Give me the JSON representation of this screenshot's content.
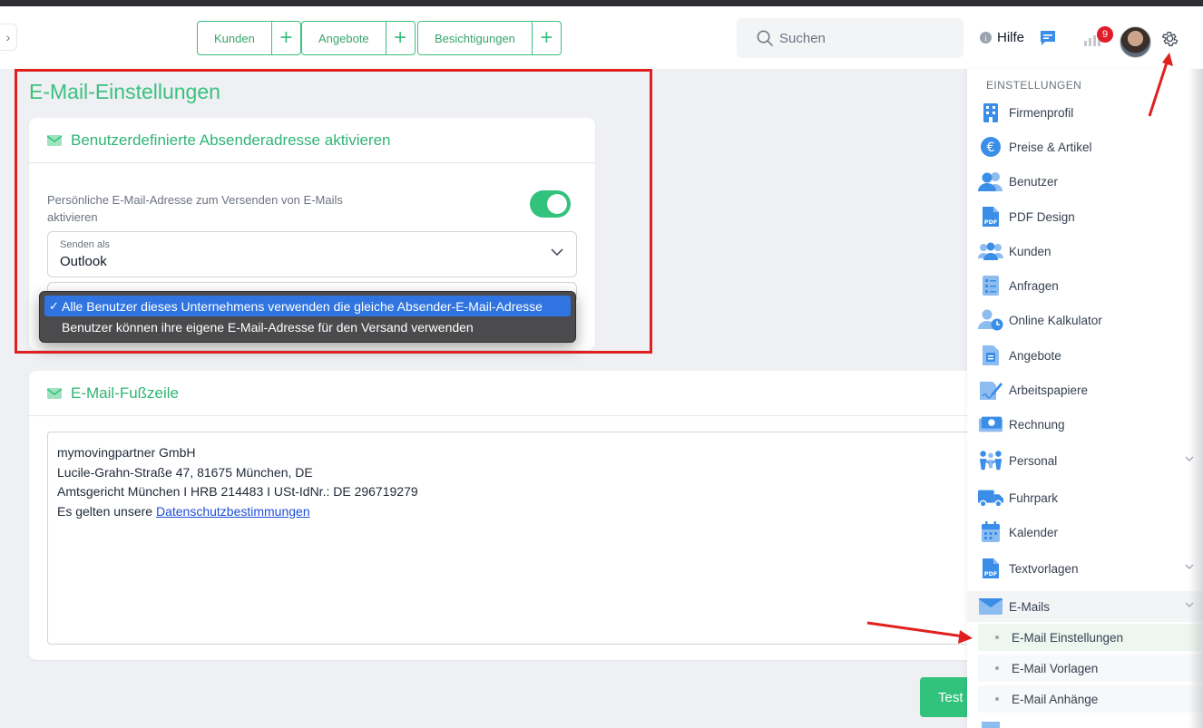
{
  "header": {
    "quick_buttons": [
      {
        "label": "Kunden"
      },
      {
        "label": "Angebote"
      },
      {
        "label": "Besichtigungen"
      }
    ],
    "search_placeholder": "Suchen",
    "help_label": "Hilfe",
    "notification_count": "9"
  },
  "page": {
    "title": "E-Mail-Einstellungen",
    "sender_card": {
      "title": "Benutzerdefinierte Absenderadresse aktivieren",
      "description": "Persönliche E-Mail-Adresse zum Versenden von E-Mails aktivieren",
      "toggle_on": true,
      "send_as_label": "Senden als",
      "send_as_value": "Outlook",
      "dropdown_options": [
        {
          "label": "Alle Benutzer dieses Unternehmens verwenden die gleiche Absender-E-Mail-Adresse",
          "selected": true
        },
        {
          "label": "Benutzer können ihre eigene E-Mail-Adresse für den Versand verwenden",
          "selected": false
        }
      ]
    },
    "footer_card": {
      "title": "E-Mail-Fußzeile",
      "lines": [
        "mymovingpartner GmbH",
        "Lucile-Grahn-Straße 47, 81675 München, DE",
        "Amtsgericht München I HRB 214483 I USt-IdNr.: DE 296719279"
      ],
      "last_line_prefix": "Es gelten unsere ",
      "privacy_link": "Datenschutzbestimmungen"
    },
    "test_button": "Test"
  },
  "settings_menu": {
    "section_title": "EINSTELLUNGEN",
    "items": [
      {
        "label": "Firmenprofil",
        "icon": "building-icon"
      },
      {
        "label": "Preise & Artikel",
        "icon": "euro-icon"
      },
      {
        "label": "Benutzer",
        "icon": "users-icon"
      },
      {
        "label": "PDF Design",
        "icon": "pdf-icon"
      },
      {
        "label": "Kunden",
        "icon": "customers-icon"
      },
      {
        "label": "Anfragen",
        "icon": "list-icon"
      },
      {
        "label": "Online Kalkulator",
        "icon": "user-clock-icon"
      },
      {
        "label": "Angebote",
        "icon": "document-icon"
      },
      {
        "label": "Arbeitspapiere",
        "icon": "signature-icon"
      },
      {
        "label": "Rechnung",
        "icon": "money-icon"
      },
      {
        "label": "Personal",
        "icon": "team-icon"
      },
      {
        "label": "Fuhrpark",
        "icon": "truck-icon"
      },
      {
        "label": "Kalender",
        "icon": "calendar-icon"
      },
      {
        "label": "Textvorlagen",
        "icon": "pdf-icon"
      },
      {
        "label": "E-Mails",
        "icon": "envelope-icon"
      }
    ],
    "email_subitems": [
      {
        "label": "E-Mail Einstellungen",
        "active": true
      },
      {
        "label": "E-Mail Vorlagen",
        "active": false
      },
      {
        "label": "E-Mail Anhänge",
        "active": false
      }
    ]
  },
  "colors": {
    "accent": "#31c27c",
    "annotation_red": "#e0201f",
    "menu_icon_blue": "#3b8ee8"
  }
}
